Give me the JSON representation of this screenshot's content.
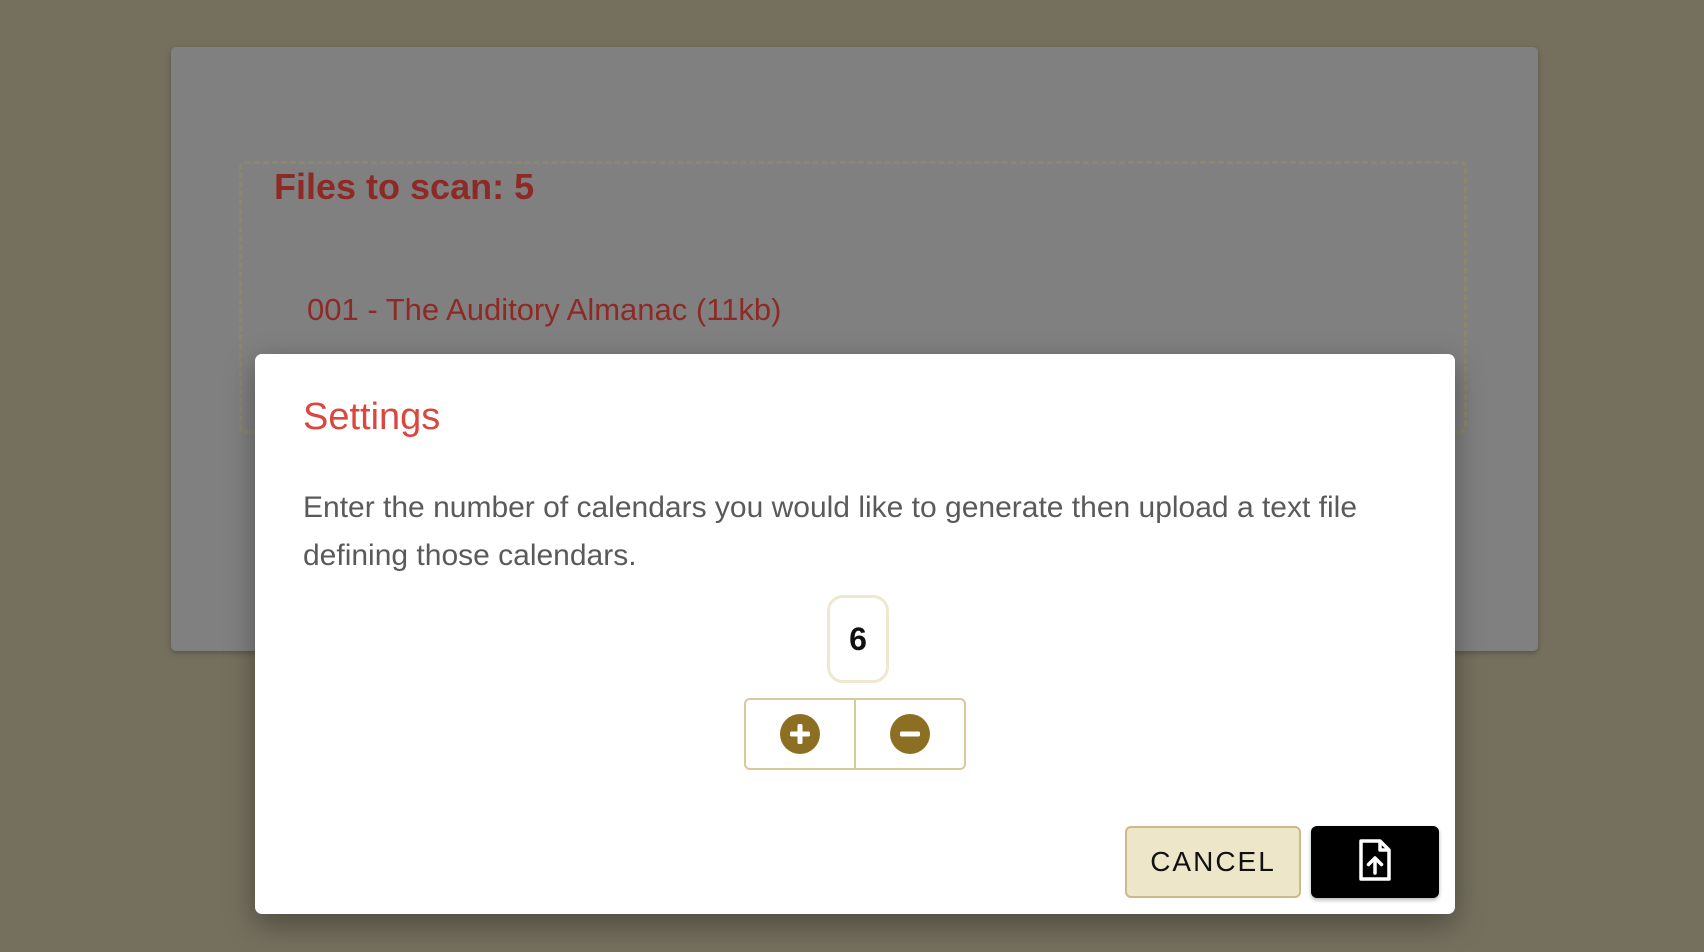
{
  "background": {
    "files_heading": "Files to scan: 5",
    "file_items": [
      "001 - The Auditory Almanac (11kb)"
    ]
  },
  "dialog": {
    "title": "Settings",
    "description": "Enter the number of calendars you would like to generate then upload a text file defining those calendars.",
    "count": "6",
    "cancel_label": "CANCEL",
    "upload_icon": "file-upload-icon",
    "increment_icon": "plus-circle-icon",
    "decrement_icon": "minus-circle-icon"
  },
  "colors": {
    "page_background": "#75705e",
    "accent_gold": "#8c6f23",
    "title_red": "#d9473f",
    "dark_red_text": "#8e2a26",
    "cancel_bg": "#ede6c8"
  }
}
